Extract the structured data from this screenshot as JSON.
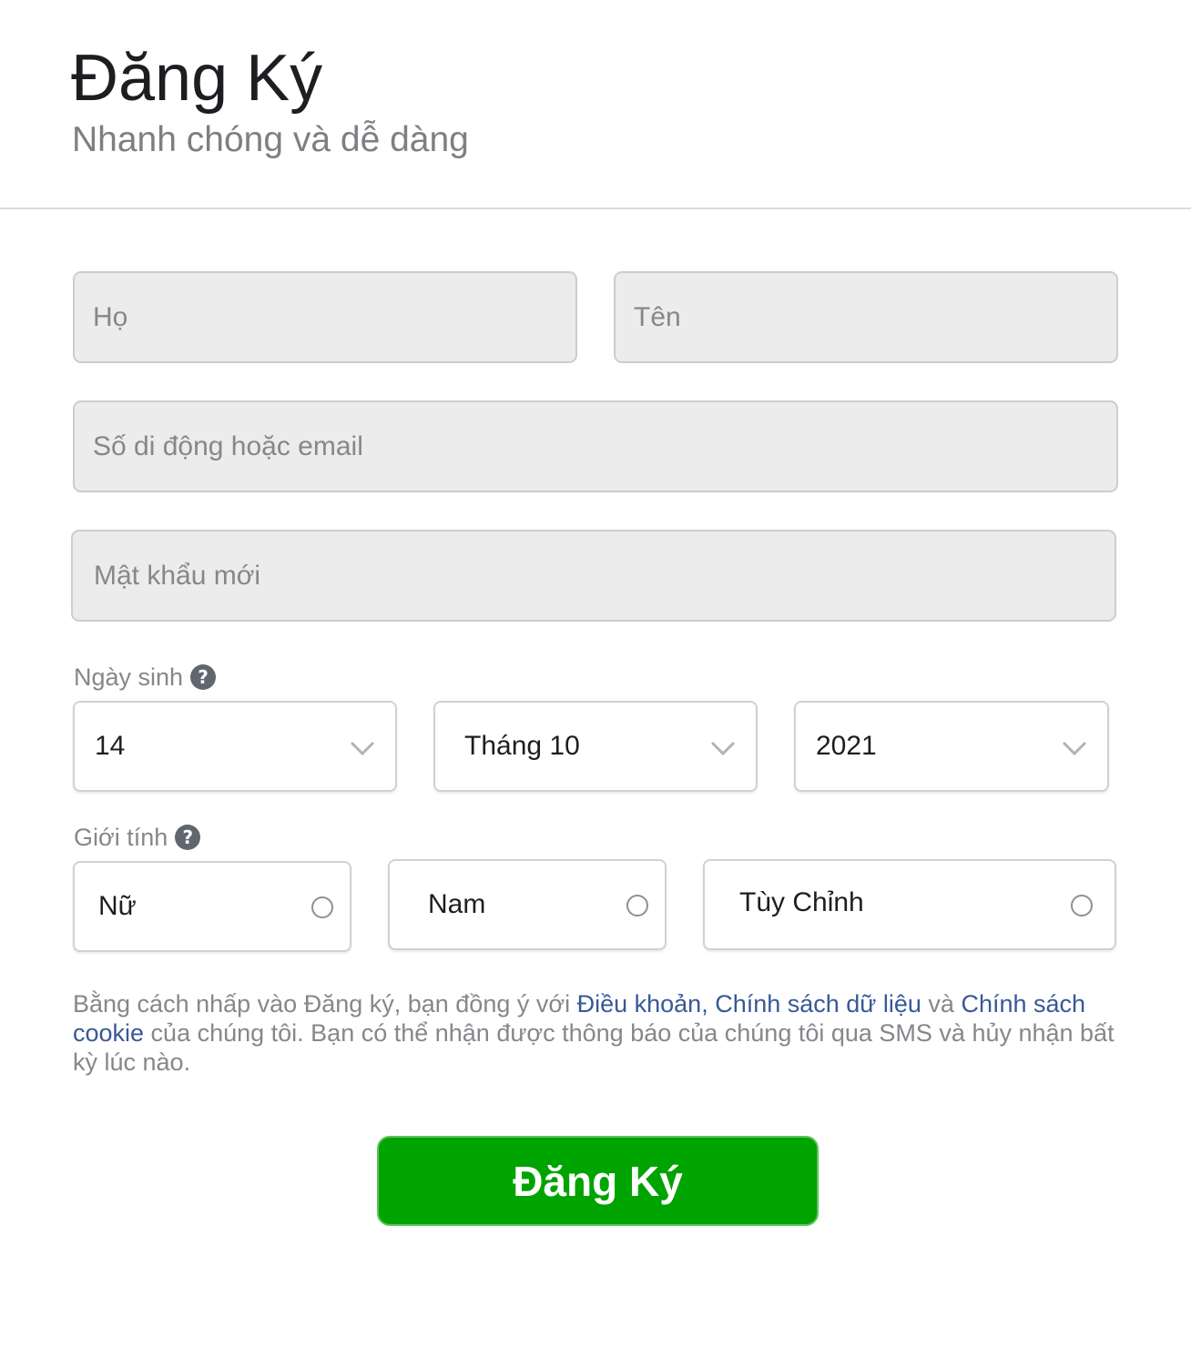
{
  "header": {
    "title": "Đăng Ký",
    "subtitle": "Nhanh chóng và dễ dàng"
  },
  "form": {
    "last_name": {
      "placeholder": "Họ",
      "value": ""
    },
    "first_name": {
      "placeholder": "Tên",
      "value": ""
    },
    "contact": {
      "placeholder": "Số di động hoặc email",
      "value": ""
    },
    "password": {
      "placeholder": "Mật khẩu mới",
      "value": ""
    }
  },
  "birthday": {
    "label": "Ngày sinh",
    "help_icon": "question-circle-icon",
    "day": "14",
    "month": "Tháng 10",
    "year": "2021",
    "dropdown_icon": "chevron-down-icon"
  },
  "gender": {
    "label": "Giới tính",
    "help_icon": "question-circle-icon",
    "options": [
      {
        "label": "Nữ",
        "selected": false
      },
      {
        "label": "Nam",
        "selected": false
      },
      {
        "label": "Tùy Chỉnh",
        "selected": false
      }
    ]
  },
  "terms": {
    "text_1": "Bằng cách nhấp vào Đăng ký, bạn đồng ý với ",
    "link_terms": "Điều khoản",
    "text_2": ", ",
    "link_data_policy": "Chính sách dữ liệu",
    "text_3": " và ",
    "link_cookie_policy": "Chính sách cookie",
    "text_4": " của chúng tôi. Bạn có thể nhận được thông báo của chúng tôi qua SMS và hủy nhận bất kỳ lúc nào."
  },
  "submit": {
    "label": "Đăng Ký"
  },
  "colors": {
    "submit_bg": "#00a400",
    "link": "#385898",
    "input_bg": "#ececec",
    "muted_text": "#85878b"
  }
}
